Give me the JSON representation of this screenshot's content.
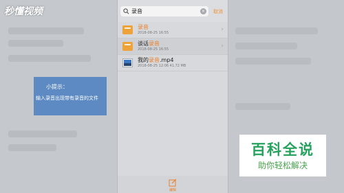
{
  "watermark": {
    "text": "秒懂视频"
  },
  "tip": {
    "title": "小提示：",
    "body": "输入录音出现带有录音的文件"
  },
  "search": {
    "query": "录音",
    "cancel_label": "取消"
  },
  "files": [
    {
      "name_parts": [
        "",
        "录音",
        ""
      ],
      "meta": "2018-08-25 16:55",
      "type": "folder"
    },
    {
      "name_parts": [
        "谈话",
        "录音",
        ""
      ],
      "meta": "2018-08-25 16:55",
      "type": "folder"
    },
    {
      "name_parts": [
        "我的",
        "录音",
        ".mp4"
      ],
      "meta": "2018-08-25 12:06    41.72 MB",
      "type": "video"
    }
  ],
  "bottom": {
    "edit_label": "编辑"
  },
  "badge": {
    "title": "百科全说",
    "subtitle": "助你轻松解决"
  },
  "colors": {
    "accent": "#f0923a",
    "highlight": "#e8812c",
    "tip_bg": "#5d8ac2",
    "badge_green": "#25a25e"
  }
}
